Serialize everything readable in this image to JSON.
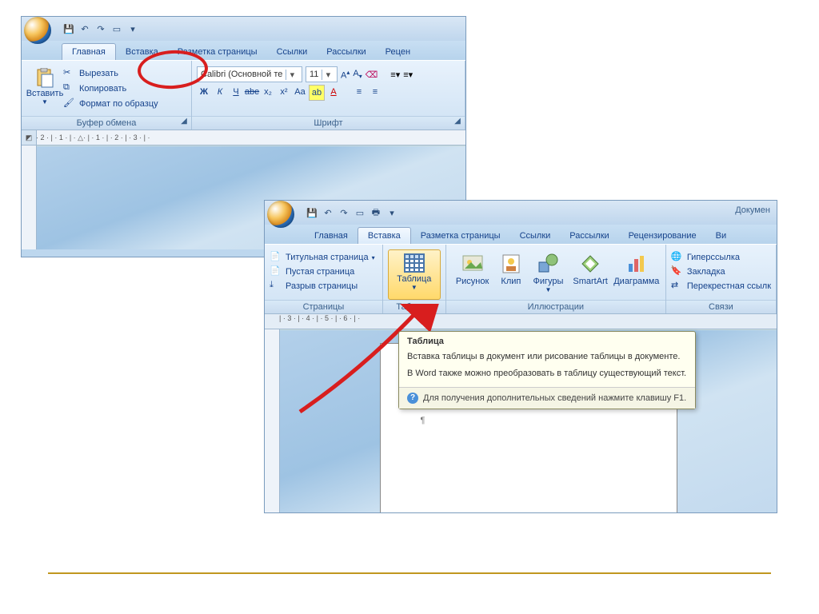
{
  "shot1": {
    "tabs": [
      "Главная",
      "Вставка",
      "Разметка страницы",
      "Ссылки",
      "Рассылки",
      "Рецен"
    ],
    "clipboard": {
      "paste": "Вставить",
      "cut": "Вырезать",
      "copy": "Копировать",
      "painter": "Формат по образцу",
      "group": "Буфер обмена"
    },
    "font": {
      "name": "Calibri (Основной те",
      "size": "11",
      "group": "Шрифт",
      "bold": "Ж",
      "italic": "К",
      "underline": "Ч",
      "strike": "abe",
      "sub": "x₂",
      "sup": "x²",
      "case": "Aa"
    },
    "ruler": "· 2 · | · 1 · | · △· | · 1 · | · 2 · | · 3 · | ·"
  },
  "shot2": {
    "docTitle": "Докумен",
    "tabs": [
      "Главная",
      "Вставка",
      "Разметка страницы",
      "Ссылки",
      "Рассылки",
      "Рецензирование",
      "Ви"
    ],
    "pages": {
      "title": "Титульная страница",
      "blank": "Пустая страница",
      "break": "Разрыв страницы",
      "group": "Страницы"
    },
    "tables": {
      "btn": "Таблица",
      "group": "Таблицы"
    },
    "illus": {
      "picture": "Рисунок",
      "clip": "Клип",
      "shapes": "Фигуры",
      "smartart": "SmartArt",
      "chart": "Диаграмма",
      "group": "Иллюстрации"
    },
    "links": {
      "hyper": "Гиперссылка",
      "bookmark": "Закладка",
      "cross": "Перекрестная ссылк",
      "group": "Связи"
    },
    "ruler": "| · 3 · | · 4 · | · 5 · | · 6 · | ·",
    "tooltip": {
      "title": "Таблица",
      "line1": "Вставка таблицы в документ или рисование таблицы в документе.",
      "line2": "В Word также можно преобразовать в таблицу существующий текст.",
      "help": "Для получения дополнительных сведений нажмите клавишу F1."
    },
    "pilcrow": "¶"
  }
}
